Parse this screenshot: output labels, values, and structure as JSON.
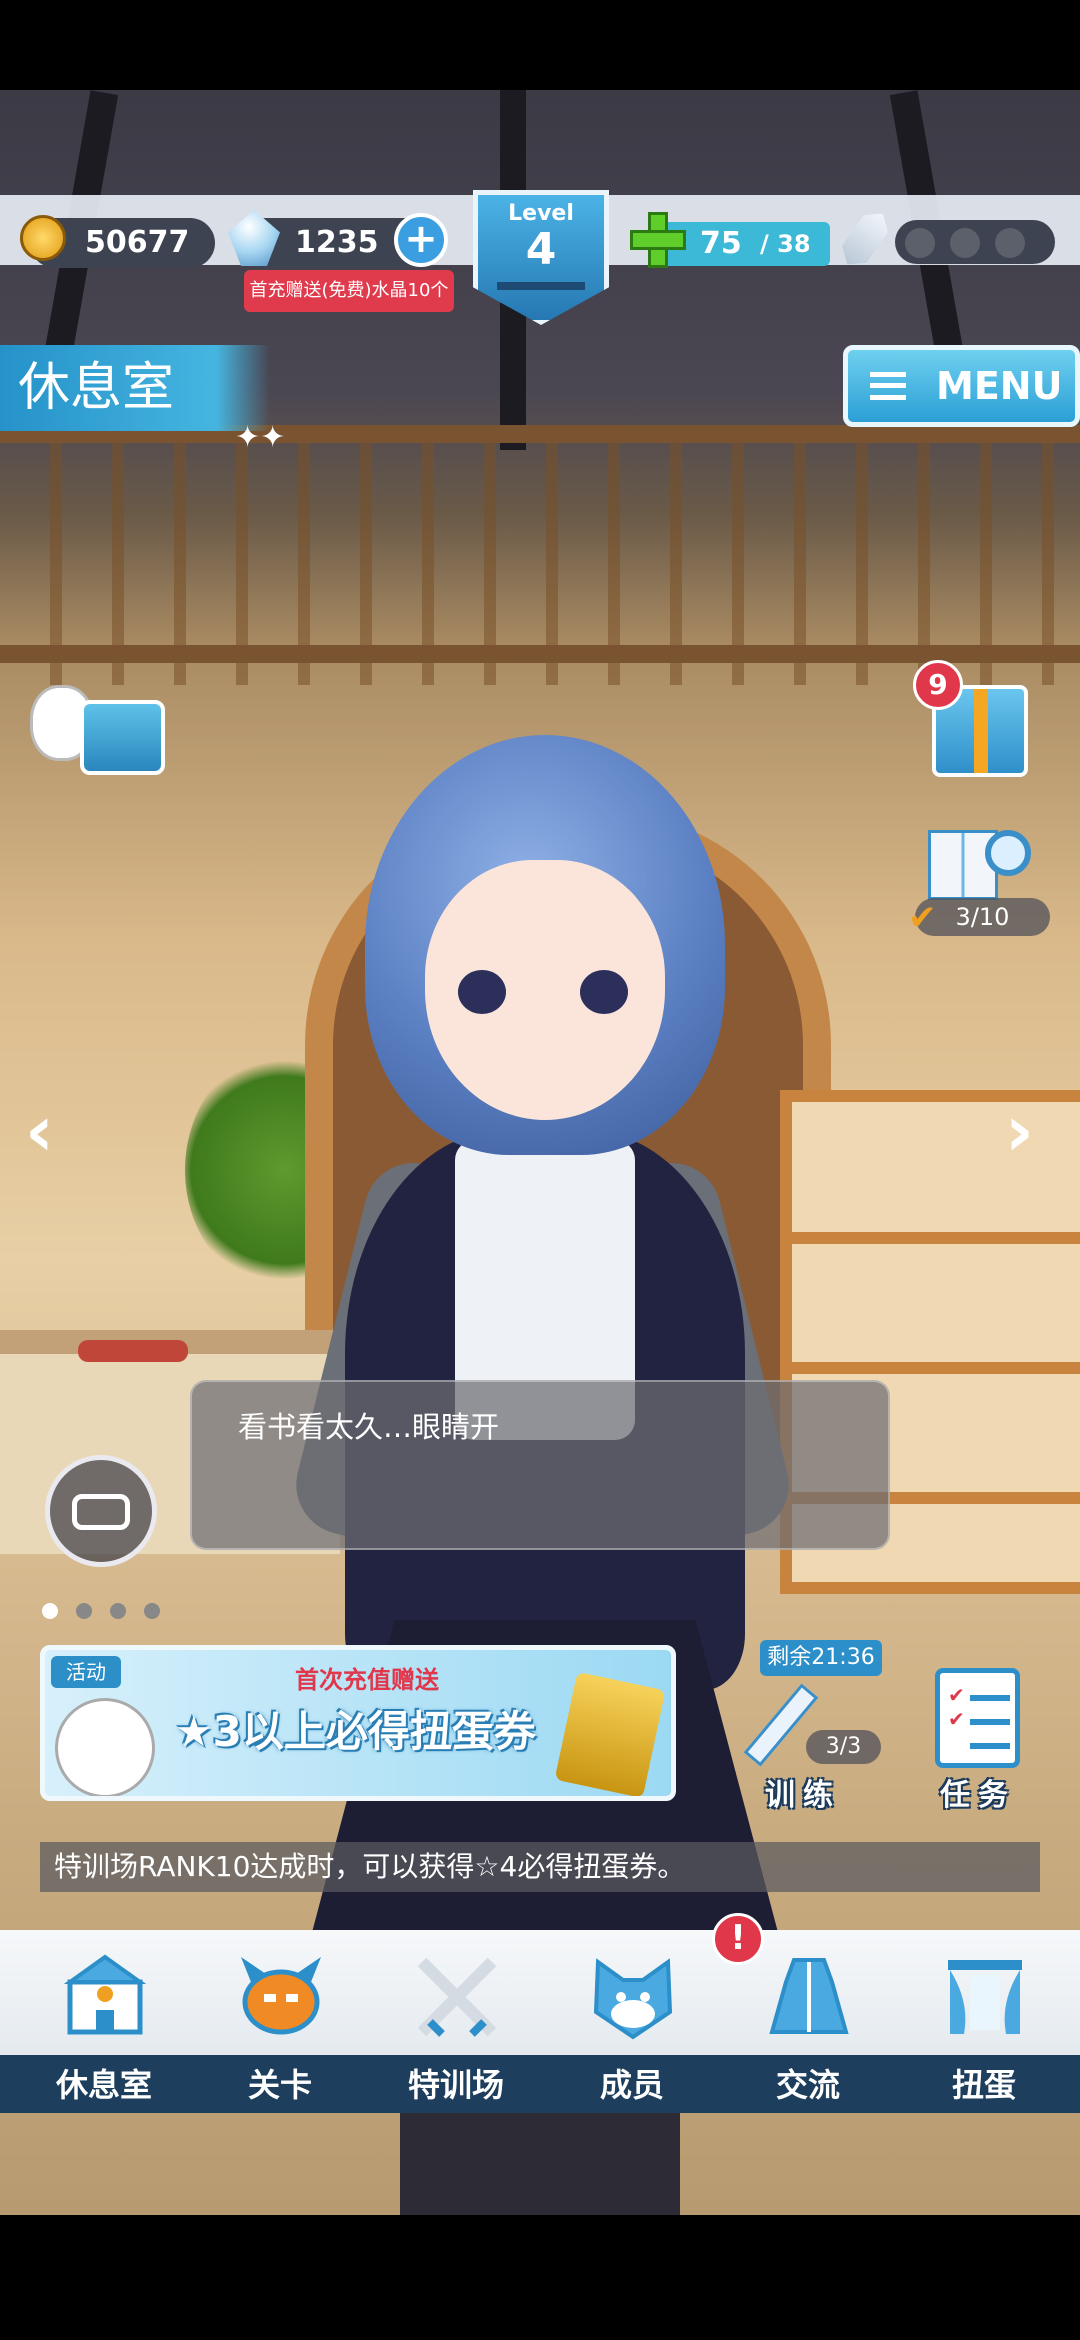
{
  "hud": {
    "gold": "50677",
    "crystals": "1235",
    "crystal_add_label": "+",
    "promo": "首充赠送(免费)水晶10个",
    "level_label": "Level",
    "level_value": "4",
    "stamina_current": "75",
    "stamina_max": "/ 38"
  },
  "room": {
    "title": "休息室",
    "sparkle": "✦✦"
  },
  "menu": {
    "label": "MENU"
  },
  "side": {
    "gift_count": "9",
    "book_progress": "3/10",
    "check": "✔",
    "arrow_left": "‹",
    "arrow_right": "›"
  },
  "dialogue": {
    "text": "看书看太久…眼睛开"
  },
  "banner": {
    "tag": "活动",
    "subtitle": "首次充值赠送",
    "main": "★3以上必得扭蛋券"
  },
  "training": {
    "timer": "剩余21:36",
    "counter": "3/3",
    "label": "训练"
  },
  "task": {
    "label": "任务",
    "tick": "✔"
  },
  "ticker": "特训场RANK10达成时，可以获得☆4必得扭蛋券。",
  "nav": [
    {
      "label": "休息室",
      "icon": "school-icon"
    },
    {
      "label": "关卡",
      "icon": "monster-icon"
    },
    {
      "label": "特训场",
      "icon": "crossed-swords-icon"
    },
    {
      "label": "成员",
      "icon": "cat-mask-icon"
    },
    {
      "label": "交流",
      "icon": "dress-icon"
    },
    {
      "label": "扭蛋",
      "icon": "curtain-icon"
    }
  ],
  "nav_alert": "!",
  "colors": {
    "accent": "#2d8fc9",
    "alert": "#e0374b",
    "nav_bg": "#1d3e5c"
  }
}
